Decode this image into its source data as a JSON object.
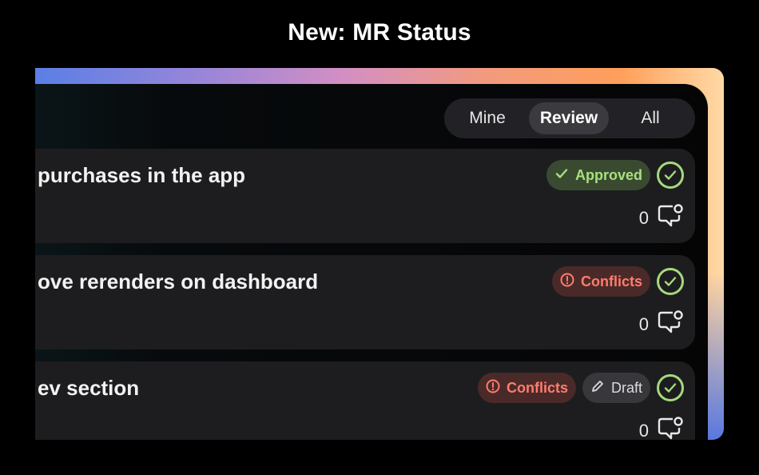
{
  "headline": "New: MR Status",
  "filter": {
    "options": [
      "Mine",
      "Review",
      "All"
    ],
    "selected": "Review"
  },
  "merge_requests": [
    {
      "title": "purchases in the app",
      "badges": [
        {
          "type": "approved",
          "label": "Approved",
          "icon": "check-icon"
        }
      ],
      "status_icon": "check-circle-icon",
      "comment_count": "0",
      "comment_icon": "comment-icon"
    },
    {
      "title": "ove rerenders on dashboard",
      "badges": [
        {
          "type": "conflicts",
          "label": "Conflicts",
          "icon": "alert-circle-icon"
        }
      ],
      "status_icon": "check-circle-icon",
      "comment_count": "0",
      "comment_icon": "comment-icon"
    },
    {
      "title": "ev section",
      "badges": [
        {
          "type": "conflicts",
          "label": "Conflicts",
          "icon": "alert-circle-icon"
        },
        {
          "type": "draft",
          "label": "Draft",
          "icon": "pencil-icon"
        }
      ],
      "status_icon": "check-circle-icon",
      "comment_count": "0",
      "comment_icon": "comment-icon"
    }
  ],
  "colors": {
    "approved": "#a7e07e",
    "conflicts": "#ff7c6e",
    "check": "#a6d97c"
  }
}
